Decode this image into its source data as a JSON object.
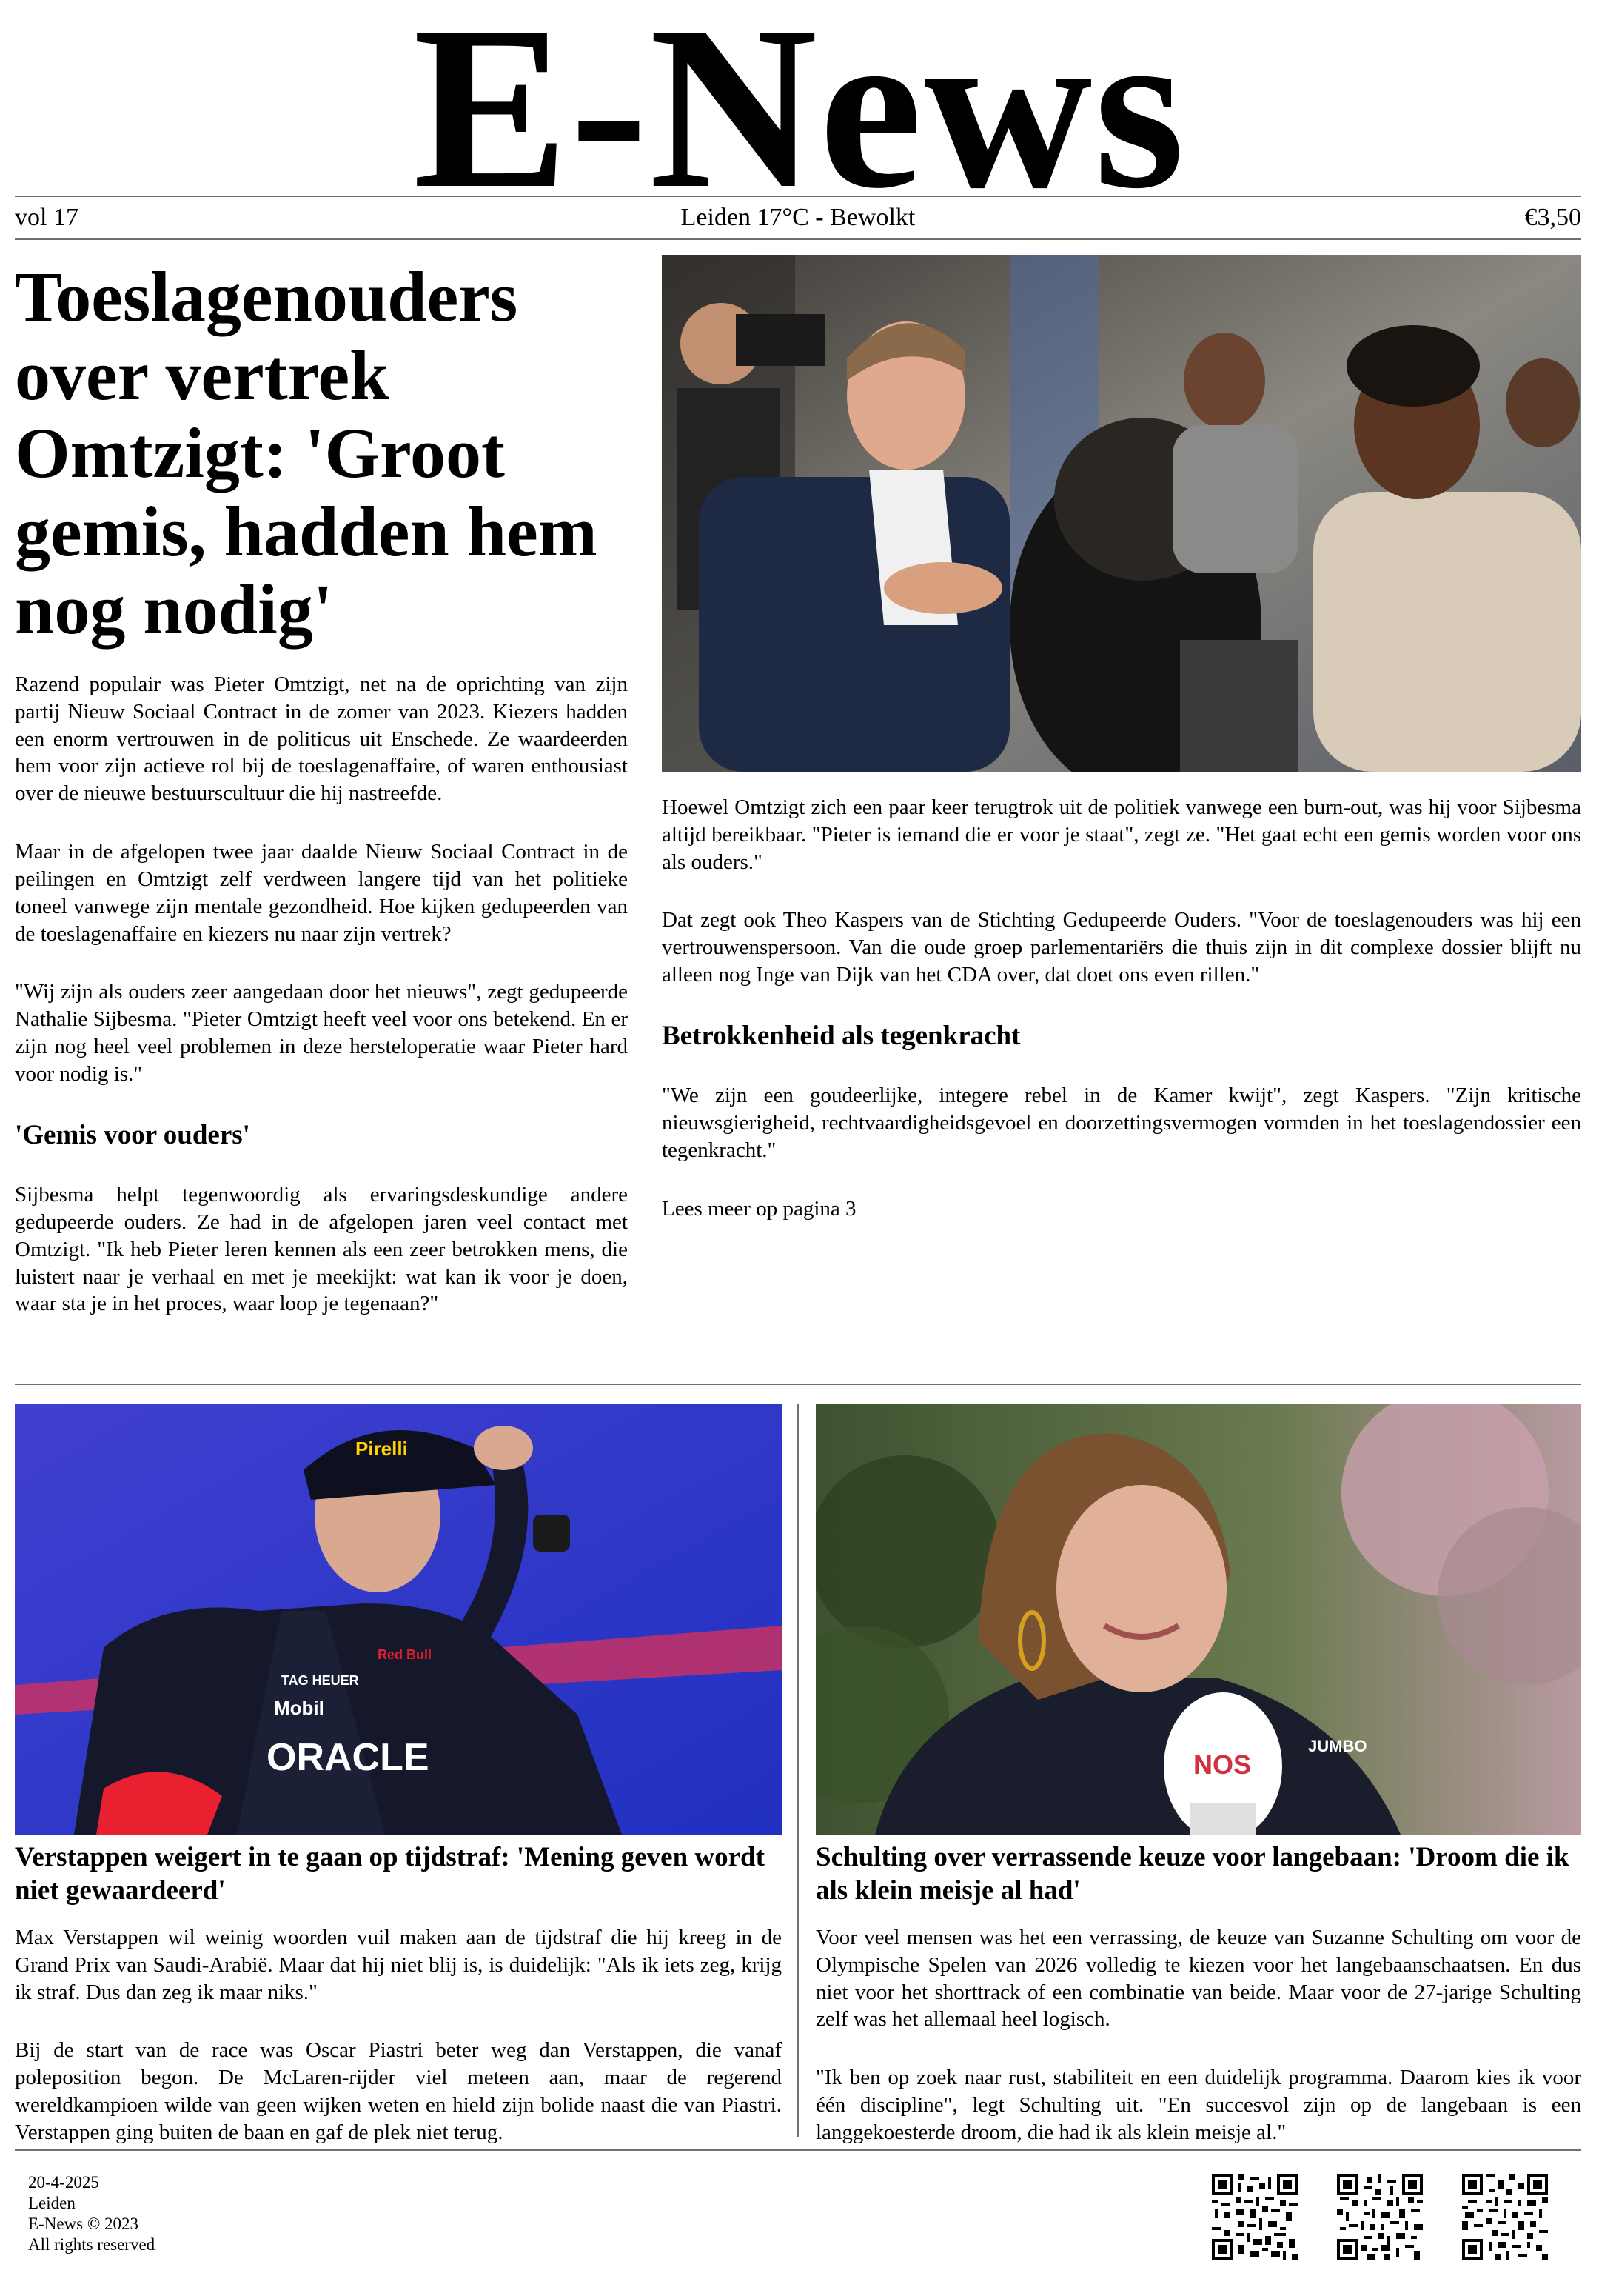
{
  "masthead": {
    "title": "E-News"
  },
  "infobar": {
    "volume": "vol 17",
    "weather": "Leiden 17°C - Bewolkt",
    "price": "€3,50"
  },
  "lead": {
    "headline": "Toeslagenouders over vertrek Omtzigt: 'Groot gemis, hadden hem nog nodig'",
    "left_paragraphs": [
      "Razend populair was Pieter Omtzigt, net na de oprichting van zijn partij Nieuw Sociaal Contract in de zomer van 2023. Kiezers hadden een enorm vertrouwen in de politicus uit Enschede. Ze waardeerden hem voor zijn actieve rol bij de toeslagenaffaire, of waren enthousiast over de nieuwe bestuurscultuur die hij nastreefde.",
      "Maar in de afgelopen twee jaar daalde Nieuw Sociaal Contract in de peilingen en Omtzigt zelf verdween langere tijd van het politieke toneel vanwege zijn mentale gezondheid. Hoe kijken gedupeerden van de toeslagenaffaire en kiezers nu naar zijn vertrek?",
      "\"Wij zijn als ouders zeer aangedaan door het nieuws\", zegt gedupeerde Nathalie Sijbesma. \"Pieter Omtzigt heeft veel voor ons betekend. En er zijn nog heel veel problemen in deze hersteloperatie waar Pieter hard voor nodig is.\""
    ],
    "subheading_1": "'Gemis voor ouders'",
    "left_paragraph_after": "Sijbesma helpt tegenwoordig als ervaringsdeskundige andere gedupeerde ouders. Ze had in de afgelopen jaren veel contact met Omtzigt. \"Ik heb Pieter leren kennen als een zeer betrokken mens, die luistert naar je verhaal en met je meekijkt: wat kan ik voor je doen, waar sta je in het proces, waar loop je tegenaan?\"",
    "right_paragraphs": [
      "Hoewel Omtzigt zich een paar keer terugtrok uit de politiek vanwege een burn-out, was hij voor Sijbesma altijd bereikbaar. \"Pieter is iemand die er voor je staat\", zegt ze. \"Het gaat echt een gemis worden voor ons als ouders.\"",
      "Dat zegt ook Theo Kaspers van de Stichting Gedupeerde Ouders. \"Voor de toeslagenouders was hij een vertrouwenspersoon. Van die oude groep parlementariërs die thuis zijn in dit complexe dossier blijft nu alleen nog Inge van Dijk van het CDA over, dat doet ons even rillen.\""
    ],
    "subheading_2": "Betrokkenheid als tegenkracht",
    "right_paragraph_after": "\"We zijn een goudeerlijke, integere rebel in de Kamer kwijt\", zegt Kaspers. \"Zijn kritische nieuwsgierigheid, rechtvaardigheidsgevoel en doorzettingsvermogen vormden in het toeslagendossier een tegenkracht.\"",
    "read_more": "Lees meer op pagina 3"
  },
  "story_left": {
    "headline": "Verstappen weigert in te gaan op tijdstraf: 'Mening geven wordt niet gewaardeerd'",
    "paragraphs": [
      "Max Verstappen wil weinig woorden vuil maken aan de tijdstraf die hij kreeg in de Grand Prix van Saudi-Arabië. Maar dat hij niet blij is, is duidelijk: \"Als ik iets zeg, krijg ik straf. Dus dan zeg ik maar niks.\"",
      "Bij de start van de race was Oscar Piastri beter weg dan Verstappen, die vanaf poleposition begon. De McLaren-rijder viel meteen aan, maar de regerend wereldkampioen wilde van geen wijken weten en hield zijn bolide naast die van Piastri. Verstappen ging buiten de baan en gaf de plek niet terug."
    ],
    "photo_text": {
      "cap_brand": "Pirelli",
      "shirt_brand": "ORACLE",
      "sponsor_1": "Mobil",
      "sponsor_2": "TAG HEUER",
      "sponsor_3": "Red Bull"
    }
  },
  "story_right": {
    "headline": "Schulting over verrassende keuze voor langebaan: 'Droom die ik als klein meisje al had'",
    "paragraphs": [
      "Voor veel mensen was het een verrassing, de keuze van Suzanne Schulting om voor de Olympische Spelen van 2026 volledig te kiezen voor het langebaanschaatsen. En dus niet voor het shorttrack of een combinatie van beide. Maar voor de 27-jarige Schulting zelf was het allemaal heel logisch.",
      "\"Ik ben op zoek naar rust, stabiliteit en een duidelijk programma. Daarom kies ik voor één discipline\", legt Schulting uit. \"En succesvol zijn op de langebaan is een langgekoesterde droom, die had ik als klein meisje al.\""
    ],
    "photo_text": {
      "mic_label": "NOS",
      "jacket_label": "JUMBO"
    }
  },
  "footer": {
    "date": "20-4-2025",
    "city": "Leiden",
    "copyright": "E-News © 2023",
    "rights": "All rights reserved"
  }
}
